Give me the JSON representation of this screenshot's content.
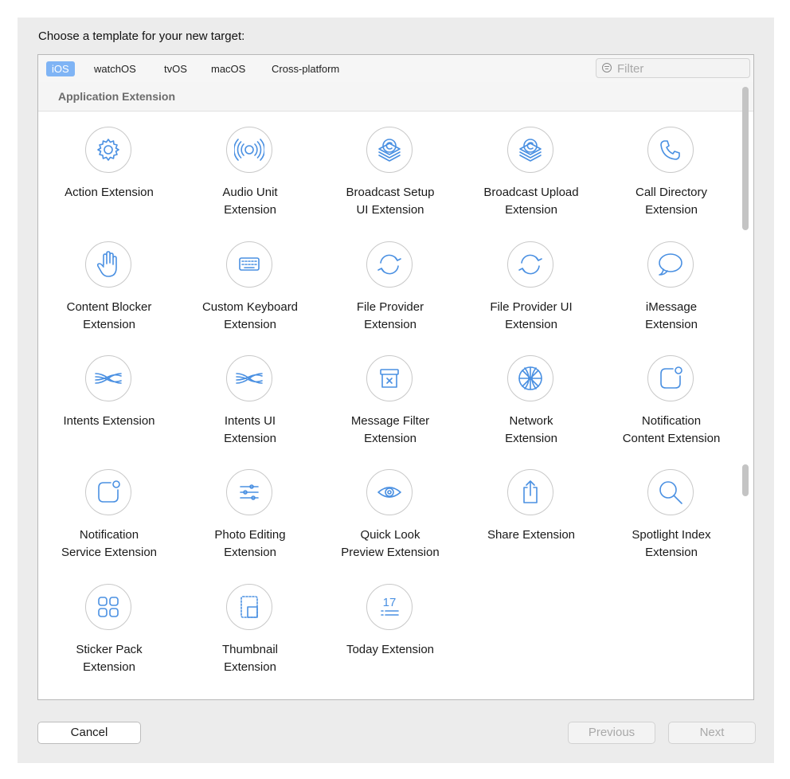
{
  "prompt": "Choose a template for your new target:",
  "tabs": [
    {
      "label": "iOS"
    },
    {
      "label": "watchOS"
    },
    {
      "label": "tvOS"
    },
    {
      "label": "macOS"
    },
    {
      "label": "Cross-platform"
    }
  ],
  "filter": {
    "placeholder": "Filter",
    "value": ""
  },
  "section": {
    "title": "Application Extension"
  },
  "templates": [
    {
      "label": "Action Extension",
      "icon": "gear-icon"
    },
    {
      "label": "Audio Unit\nExtension",
      "icon": "audio-waves-icon"
    },
    {
      "label": "Broadcast Setup\nUI Extension",
      "icon": "broadcast-stack-icon"
    },
    {
      "label": "Broadcast Upload\nExtension",
      "icon": "broadcast-stack-icon"
    },
    {
      "label": "Call Directory\nExtension",
      "icon": "phone-icon"
    },
    {
      "label": "Content Blocker\nExtension",
      "icon": "hand-icon"
    },
    {
      "label": "Custom Keyboard\nExtension",
      "icon": "keyboard-icon"
    },
    {
      "label": "File Provider\nExtension",
      "icon": "sync-arrows-icon"
    },
    {
      "label": "File Provider UI\nExtension",
      "icon": "sync-arrows-icon"
    },
    {
      "label": "iMessage\nExtension",
      "icon": "speech-bubble-icon"
    },
    {
      "label": "Intents Extension",
      "icon": "intents-waves-icon"
    },
    {
      "label": "Intents UI\nExtension",
      "icon": "intents-waves-icon"
    },
    {
      "label": "Message Filter\nExtension",
      "icon": "filter-box-icon"
    },
    {
      "label": "Network\nExtension",
      "icon": "globe-icon"
    },
    {
      "label": "Notification\nContent Extension",
      "icon": "notification-square-icon"
    },
    {
      "label": "Notification\nService Extension",
      "icon": "notification-square-icon"
    },
    {
      "label": "Photo Editing\nExtension",
      "icon": "sliders-icon"
    },
    {
      "label": "Quick Look\nPreview Extension",
      "icon": "eye-icon"
    },
    {
      "label": "Share Extension",
      "icon": "share-icon"
    },
    {
      "label": "Spotlight Index\nExtension",
      "icon": "magnifier-icon"
    },
    {
      "label": "Sticker Pack\nExtension",
      "icon": "grid-squares-icon"
    },
    {
      "label": "Thumbnail\nExtension",
      "icon": "thumbnail-icon"
    },
    {
      "label": "Today Extension",
      "icon": "today-calendar-icon"
    }
  ],
  "buttons": {
    "cancel": "Cancel",
    "previous": "Previous",
    "next": "Next"
  },
  "colors": {
    "accent": "#4a90e2",
    "tab_selected": "#7fb4f5"
  }
}
